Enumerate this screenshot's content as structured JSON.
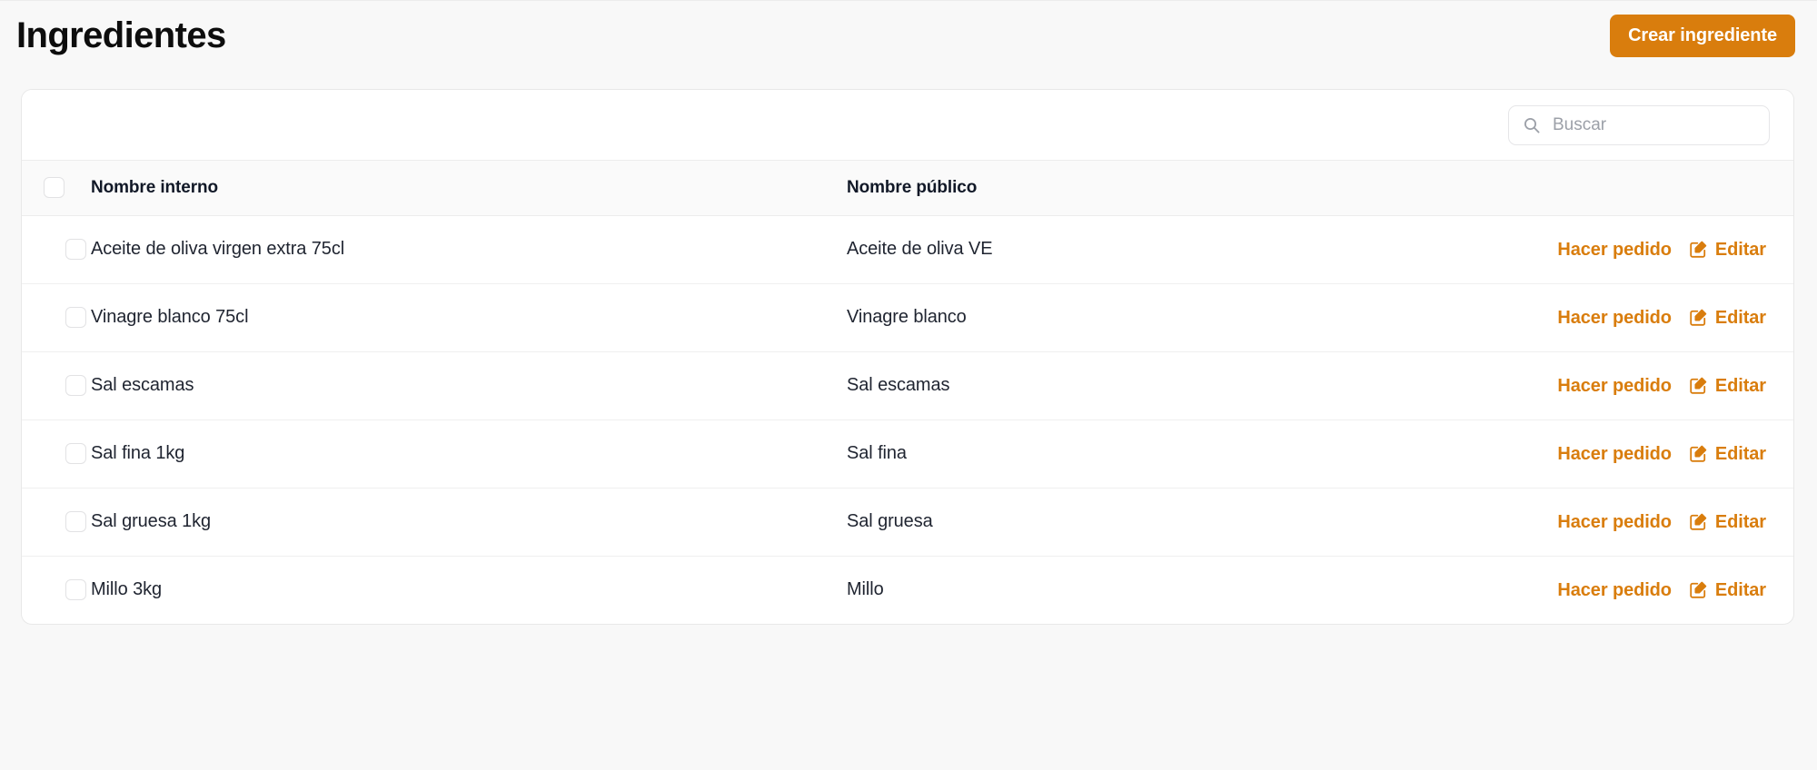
{
  "header": {
    "title": "Ingredientes",
    "create_button_label": "Crear ingrediente"
  },
  "colors": {
    "accent": "#d97d0d",
    "page_background": "#f8f8f8",
    "card_background": "#ffffff",
    "header_row_background": "#fafafa",
    "border": "#ececec",
    "text": "#111827"
  },
  "search": {
    "placeholder": "Buscar",
    "value": "",
    "icon": "search-icon"
  },
  "table": {
    "columns": [
      {
        "key": "select",
        "label": ""
      },
      {
        "key": "internal_name",
        "label": "Nombre interno"
      },
      {
        "key": "public_name",
        "label": "Nombre público"
      },
      {
        "key": "actions",
        "label": ""
      }
    ],
    "header_select_all_checked": false,
    "actions": {
      "order_label": "Hacer pedido",
      "edit_label": "Editar",
      "edit_icon": "edit-pencil-square-icon"
    },
    "rows": [
      {
        "selected": false,
        "internal_name": "Aceite de oliva virgen extra 75cl",
        "public_name": "Aceite de oliva VE"
      },
      {
        "selected": false,
        "internal_name": "Vinagre blanco 75cl",
        "public_name": "Vinagre blanco"
      },
      {
        "selected": false,
        "internal_name": "Sal escamas",
        "public_name": "Sal escamas"
      },
      {
        "selected": false,
        "internal_name": "Sal fina 1kg",
        "public_name": "Sal fina"
      },
      {
        "selected": false,
        "internal_name": "Sal gruesa 1kg",
        "public_name": "Sal gruesa"
      },
      {
        "selected": false,
        "internal_name": "Millo 3kg",
        "public_name": "Millo"
      }
    ]
  }
}
